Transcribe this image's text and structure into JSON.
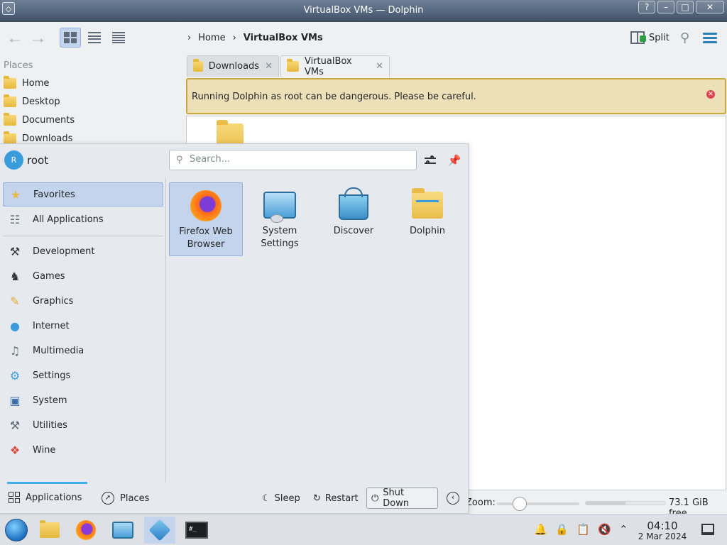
{
  "window": {
    "title": "VirtualBox VMs — Dolphin"
  },
  "titlebar": {
    "left_icons": [
      "◇"
    ],
    "right_buttons": [
      "?",
      "–",
      "□",
      "✕"
    ]
  },
  "breadcrumb": {
    "home": "Home",
    "current": "VirtualBox VMs"
  },
  "toolbar": {
    "split_label": "Split"
  },
  "places": {
    "header": "Places",
    "items": [
      {
        "label": "Home"
      },
      {
        "label": "Desktop"
      },
      {
        "label": "Documents"
      },
      {
        "label": "Downloads"
      }
    ]
  },
  "tabs": [
    {
      "label": "Downloads",
      "active": false
    },
    {
      "label": "VirtualBox VMs",
      "active": true
    }
  ],
  "warning": {
    "message": "Running Dolphin as root can be dangerous. Please be careful."
  },
  "statusbar": {
    "zoom_label": "Zoom:",
    "free_space": "73.1 GiB free",
    "used_fraction": 0.5
  },
  "launcher": {
    "user": {
      "initial": "R",
      "name": "root"
    },
    "search": {
      "placeholder": "Search..."
    },
    "categories": [
      {
        "label": "Favorites",
        "icon": "favorites-icon",
        "selected": true
      },
      {
        "label": "All Applications",
        "icon": "all-apps-icon",
        "selected": false
      },
      {
        "label": "Development",
        "icon": "development-icon",
        "selected": false
      },
      {
        "label": "Games",
        "icon": "games-icon",
        "selected": false
      },
      {
        "label": "Graphics",
        "icon": "graphics-icon",
        "selected": false
      },
      {
        "label": "Internet",
        "icon": "internet-icon",
        "selected": false
      },
      {
        "label": "Multimedia",
        "icon": "multimedia-icon",
        "selected": false
      },
      {
        "label": "Settings",
        "icon": "settings-icon",
        "selected": false
      },
      {
        "label": "System",
        "icon": "system-icon",
        "selected": false
      },
      {
        "label": "Utilities",
        "icon": "utilities-icon",
        "selected": false
      },
      {
        "label": "Wine",
        "icon": "wine-icon",
        "selected": false
      }
    ],
    "favorites": [
      {
        "label": "Firefox Web Browser",
        "line1": "Firefox Web",
        "line2": "Browser",
        "icon": "firefox-icon"
      },
      {
        "label": "System Settings",
        "line1": "System",
        "line2": "Settings",
        "icon": "system-settings-icon"
      },
      {
        "label": "Discover",
        "line1": "Discover",
        "line2": "",
        "icon": "discover-icon"
      },
      {
        "label": "Dolphin",
        "line1": "Dolphin",
        "line2": "",
        "icon": "dolphin-icon"
      }
    ],
    "footer": {
      "applications": "Applications",
      "places": "Places",
      "sleep": "Sleep",
      "restart": "Restart",
      "shutdown": "Shut Down"
    }
  },
  "taskbar": {
    "apps": [
      "file-manager-icon",
      "firefox-icon",
      "system-settings-icon",
      "virtualbox-icon",
      "terminal-icon"
    ],
    "clock": {
      "time": "04:10",
      "date": "2 Mar 2024"
    }
  },
  "colors": {
    "accent": "#3daee9",
    "selection": "#c3d4ec",
    "warning_bg": "#ede0b9",
    "warning_border": "#c9a93c",
    "error": "#da4453"
  }
}
